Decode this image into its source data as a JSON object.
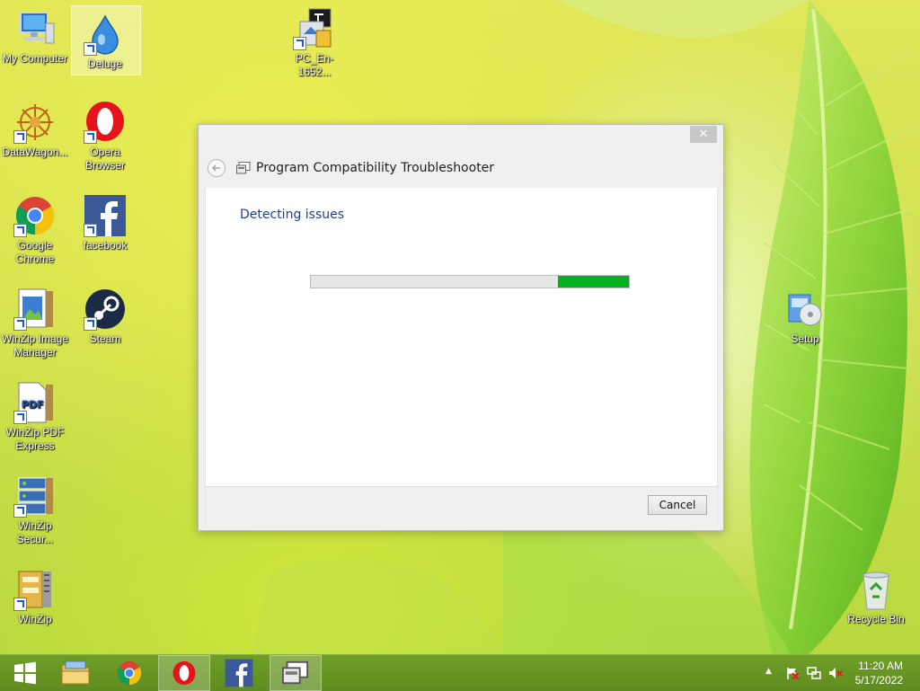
{
  "desktop": {
    "icons": [
      {
        "label": "My Computer"
      },
      {
        "label": "Deluge"
      },
      {
        "label": "PC_En-1652..."
      },
      {
        "label": "DataWagon..."
      },
      {
        "label": "Opera Browser"
      },
      {
        "label": "Google Chrome"
      },
      {
        "label": "facebook"
      },
      {
        "label": "WinZip Image Manager"
      },
      {
        "label": "Steam"
      },
      {
        "label": "Setup"
      },
      {
        "label": "WinZip PDF Express"
      },
      {
        "label": "WinZip Secur..."
      },
      {
        "label": "WinZip"
      },
      {
        "label": "Recycle Bin"
      }
    ]
  },
  "dialog": {
    "title": "Program Compatibility Troubleshooter",
    "heading": "Detecting issues",
    "close_glyph": "✕",
    "progress": {
      "state": "indeterminate",
      "fill_color": "#06b025"
    },
    "cancel_label": "Cancel"
  },
  "taskbar": {
    "items": [
      "Start",
      "File Explorer",
      "Google Chrome",
      "Opera Browser",
      "facebook",
      "Program Compatibility Troubleshooter"
    ],
    "active_item": "Program Compatibility Troubleshooter",
    "tray": {
      "time": "11:20 AM",
      "date": "5/17/2022",
      "show_hidden_glyph": "▲"
    }
  },
  "colors": {
    "taskbar": "#6a9824",
    "heading": "#1e3f8a",
    "progress_green": "#06b025"
  }
}
